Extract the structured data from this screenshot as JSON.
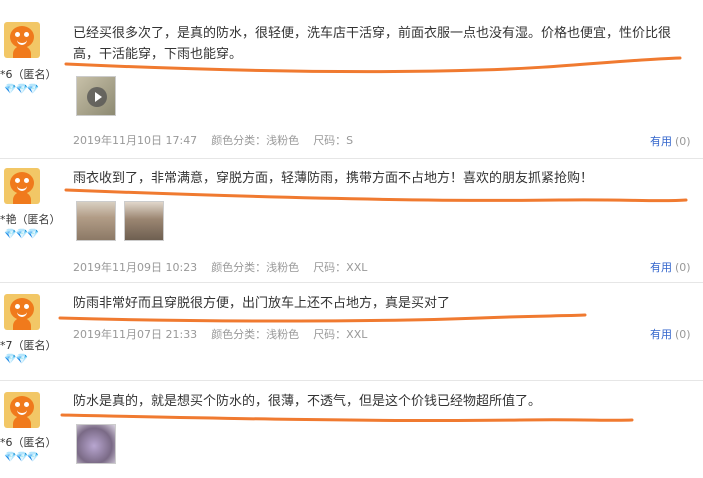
{
  "reviews": [
    {
      "user": "*6（匿名）",
      "gems": "💎💎💎",
      "content": "已经买很多次了，是真的防水，很轻便，洗车店干活穿，前面衣服一点也没有湿。价格也便宜，性价比很高，干活能穿，下雨也能穿。",
      "date": "2019年11月10日 17:47",
      "color": "颜色分类：浅粉色",
      "size": "尺码：S",
      "helpful_label": "有用",
      "helpful_count": "(0)"
    },
    {
      "user": "*艳（匿名）",
      "gems": "💎💎💎",
      "content": "雨衣收到了，非常满意，穿脱方面，轻薄防雨，携带方面不占地方！喜欢的朋友抓紧抢购！",
      "date": "2019年11月09日 10:23",
      "color": "颜色分类：浅粉色",
      "size": "尺码：XXL",
      "helpful_label": "有用",
      "helpful_count": "(0)"
    },
    {
      "user": "*7（匿名）",
      "gems": "💎💎",
      "content": "防雨非常好而且穿脱很方便，出门放车上还不占地方，真是买对了",
      "date": "2019年11月07日 21:33",
      "color": "颜色分类：浅粉色",
      "size": "尺码：XXL",
      "helpful_label": "有用",
      "helpful_count": "(0)"
    },
    {
      "user": "*6（匿名）",
      "gems": "💎💎💎",
      "content": "防水是真的，就是想买个防水的，很薄，不透气，但是这个价钱已经物超所值了。",
      "date": "",
      "color": "",
      "size": "",
      "helpful_label": "",
      "helpful_count": ""
    }
  ],
  "colors": {
    "annotation": "#f07a30",
    "link": "#3366cc",
    "meta": "#999999"
  }
}
